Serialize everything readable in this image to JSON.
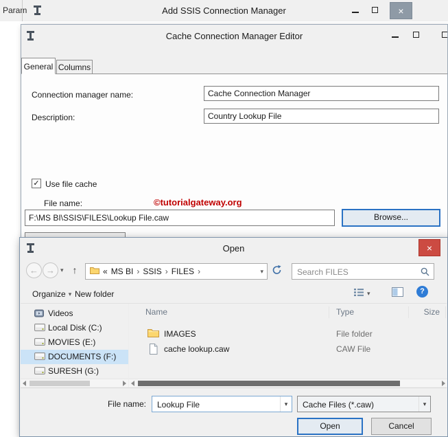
{
  "glyphs": {
    "minimize": "–",
    "close": "×",
    "chevron_down": "▾",
    "back_arrow": "←",
    "forward_arrow": "→",
    "up_arrow": "↑",
    "check": "✓",
    "help": "?"
  },
  "colors": {
    "close_button_red": "#cc4b42",
    "inactive_close_gray": "#8e9aa6",
    "focus_border_blue": "#2a72c4",
    "selection_blue": "#cbe3f7",
    "watermark_red": "#c00000"
  },
  "background_window": {
    "left_panel_label": "Param",
    "title": "Add SSIS Connection Manager"
  },
  "editor_window": {
    "title": "Cache Connection Manager Editor",
    "tabs": [
      "General",
      "Columns"
    ],
    "connection_name_label": "Connection manager name:",
    "connection_name_value": "Cache Connection Manager",
    "description_label": "Description:",
    "description_value": "Country Lookup File",
    "use_file_cache_label": "Use file cache",
    "use_file_cache_checked": true,
    "file_name_label": "File name:",
    "watermark": "©tutorialgateway.org",
    "file_path_value": "F:\\MS BI\\SSIS\\FILES\\Lookup File.caw",
    "browse_button": "Browse..."
  },
  "open_dialog": {
    "title": "Open",
    "breadcrumb": {
      "overflow": "«",
      "items": [
        "MS BI",
        "SSIS",
        "FILES"
      ],
      "separator": "›"
    },
    "search_placeholder": "Search FILES",
    "toolbar": {
      "organize": "Organize",
      "new_folder": "New folder"
    },
    "nav_pane": {
      "items": [
        "Videos",
        "Local Disk (C:)",
        "MOVIES (E:)",
        "DOCUMENTS (F:)",
        "SURESH (G:)"
      ],
      "selected": "DOCUMENTS (F:)"
    },
    "file_list": {
      "columns": [
        "Name",
        "Type",
        "Size"
      ],
      "rows": [
        {
          "name": "IMAGES",
          "type": "File folder"
        },
        {
          "name": "cache lookup.caw",
          "type": "CAW File"
        }
      ]
    },
    "file_name_label": "File name:",
    "file_name_value": "Lookup File",
    "file_type_value": "Cache Files (*.caw)",
    "open_button": "Open",
    "cancel_button": "Cancel"
  }
}
